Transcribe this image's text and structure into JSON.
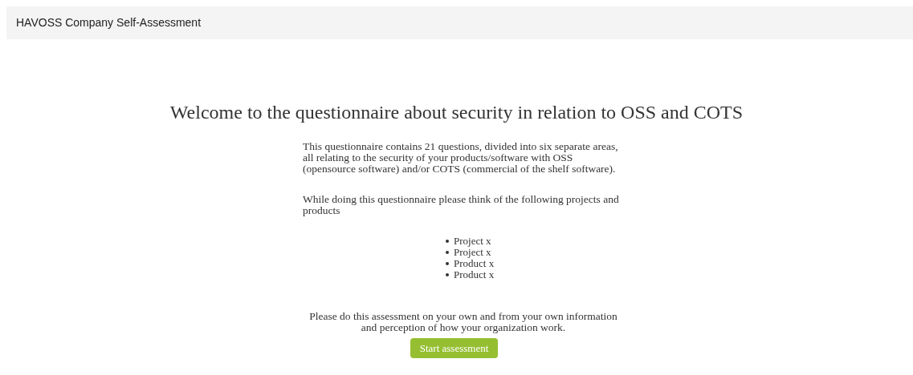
{
  "navbar": {
    "brand": "HAVOSS Company Self-Assessment"
  },
  "main": {
    "heading": "Welcome to the questionnaire about security in relation to OSS and COTS",
    "paragraphs": [
      "This questionnaire contains 21 questions, divided into six separate areas, all relating to the security of your products/software with OSS (opensource software) and/or COTS (commercial of the shelf software).",
      "While doing this questionnaire please think of the following projects and products"
    ],
    "items": [
      "Project x",
      "Project x",
      "Product x",
      "Product x"
    ],
    "note": "Please do this assessment on your own and from your own information and perception of how your organization work.",
    "button": "Start assessment"
  }
}
